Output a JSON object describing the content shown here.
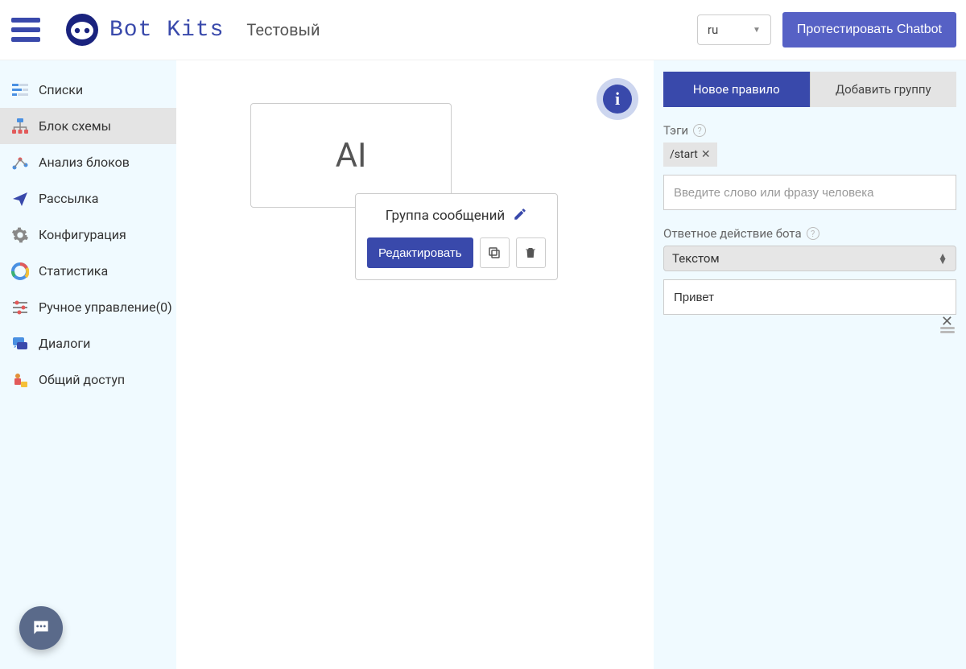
{
  "header": {
    "logo_text": "Bot Kits",
    "breadcrumb": "Тестовый",
    "lang_value": "ru",
    "test_button": "Протестировать Chatbot"
  },
  "sidebar": {
    "items": [
      {
        "label": "Списки"
      },
      {
        "label": "Блок схемы"
      },
      {
        "label": "Анализ блоков"
      },
      {
        "label": "Рассылка"
      },
      {
        "label": "Конфигурация"
      },
      {
        "label": "Статистика"
      },
      {
        "label": "Ручное управление(0)"
      },
      {
        "label": "Диалоги"
      },
      {
        "label": "Общий доступ"
      }
    ]
  },
  "canvas": {
    "ai_card_label": "AI",
    "group_title": "Группа сообщений",
    "edit_button": "Редактировать"
  },
  "panel": {
    "tab_new_rule": "Новое правило",
    "tab_add_group": "Добавить группу",
    "tags_label": "Тэги",
    "tag_value": "/start",
    "phrase_placeholder": "Введите слово или фразу человека",
    "response_label": "Ответное действие бота",
    "response_select": "Текстом",
    "response_text": "Привет"
  }
}
